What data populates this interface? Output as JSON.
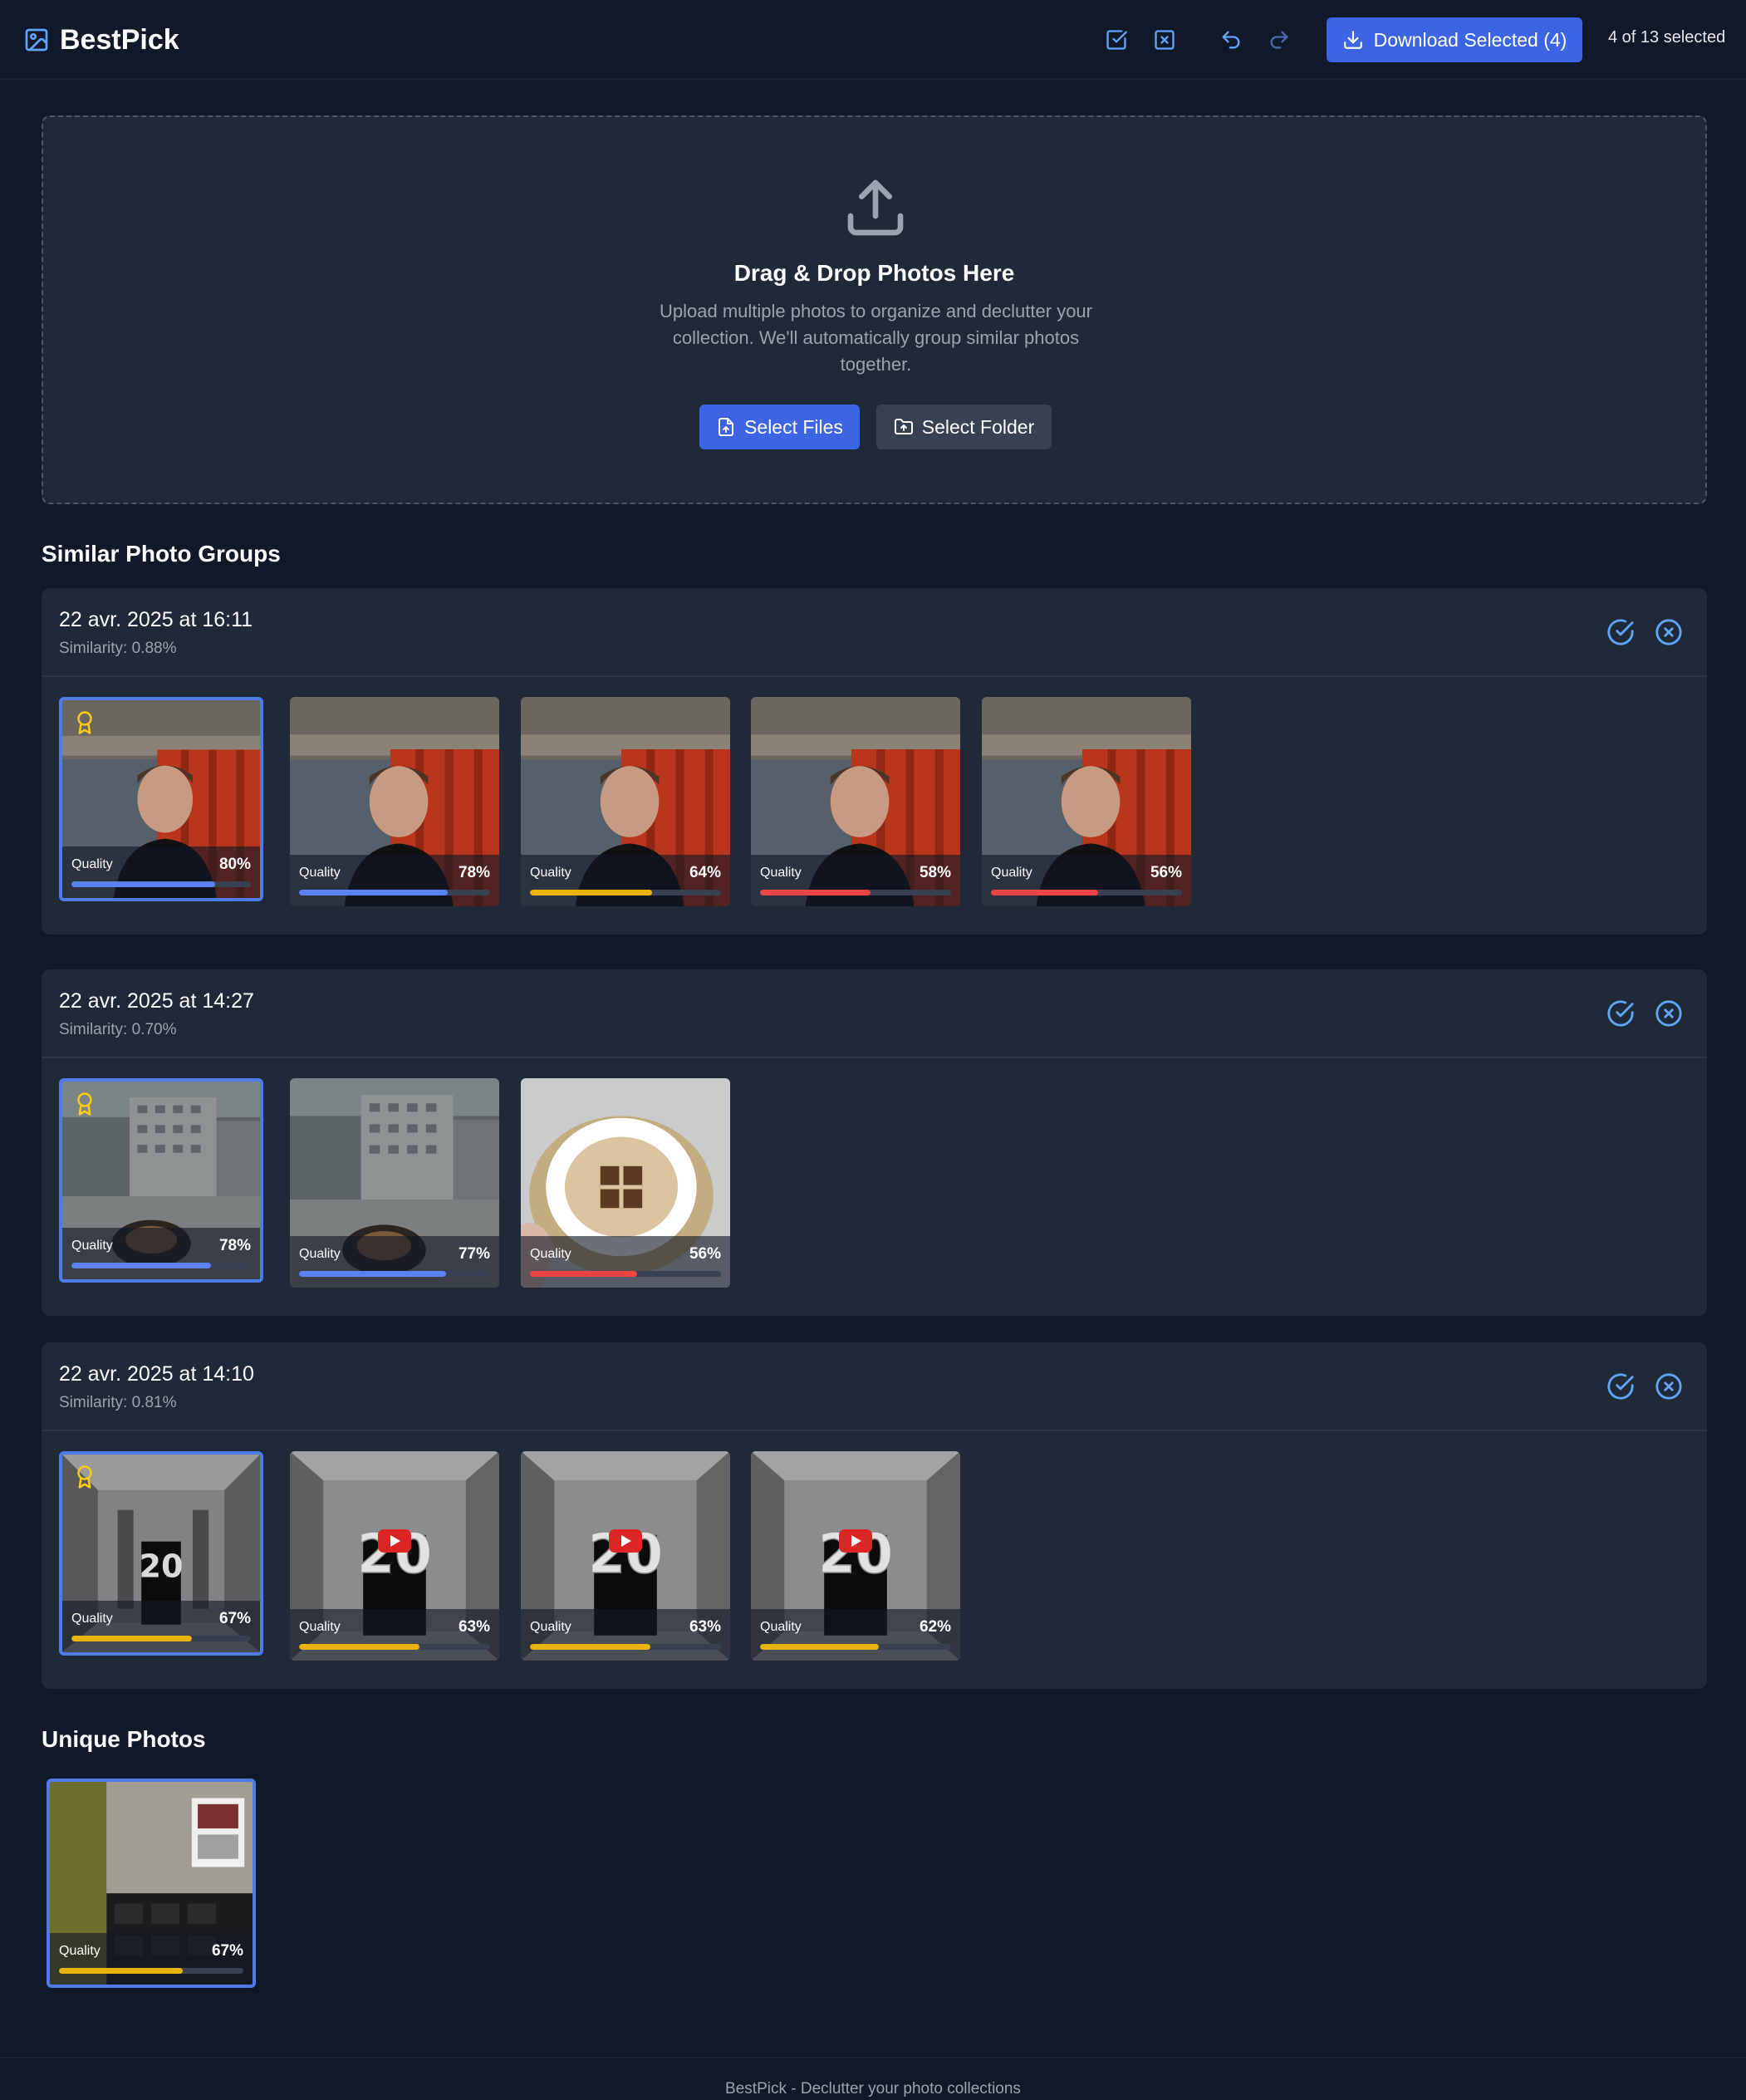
{
  "app": {
    "title": "BestPick"
  },
  "header": {
    "download_label": "Download Selected (4)",
    "selected_count": "4 of 13 selected"
  },
  "dropzone": {
    "title": "Drag & Drop Photos Here",
    "subtitle": "Upload multiple photos to organize and declutter your collection. We'll automatically group similar photos together.",
    "select_files": "Select Files",
    "select_folder": "Select Folder"
  },
  "similar": {
    "title": "Similar Photo Groups",
    "groups": [
      {
        "date": "22 avr. 2025 at 16:11",
        "similarity": "Similarity: 0.88%",
        "photos": [
          {
            "quality_label": "Quality",
            "quality": "80%",
            "value": 0.8,
            "best": true,
            "scene": "selfie",
            "color": "#5b82f0"
          },
          {
            "quality_label": "Quality",
            "quality": "78%",
            "value": 0.78,
            "scene": "selfie",
            "color": "#5b82f0"
          },
          {
            "quality_label": "Quality",
            "quality": "64%",
            "value": 0.64,
            "scene": "selfie",
            "color": "#eab308"
          },
          {
            "quality_label": "Quality",
            "quality": "58%",
            "value": 0.58,
            "scene": "selfie",
            "color": "#ef4444"
          },
          {
            "quality_label": "Quality",
            "quality": "56%",
            "value": 0.56,
            "scene": "selfie",
            "color": "#ef4444"
          }
        ]
      },
      {
        "date": "22 avr. 2025 at 14:27",
        "similarity": "Similarity: 0.70%",
        "photos": [
          {
            "quality_label": "Quality",
            "quality": "78%",
            "value": 0.78,
            "best": true,
            "scene": "building",
            "color": "#5b82f0"
          },
          {
            "quality_label": "Quality",
            "quality": "77%",
            "value": 0.77,
            "scene": "building",
            "color": "#5b82f0"
          },
          {
            "quality_label": "Quality",
            "quality": "56%",
            "value": 0.56,
            "scene": "coffee",
            "color": "#ef4444"
          }
        ]
      },
      {
        "date": "22 avr. 2025 at 14:10",
        "similarity": "Similarity: 0.81%",
        "photos": [
          {
            "quality_label": "Quality",
            "quality": "67%",
            "value": 0.67,
            "best": true,
            "scene": "hallway",
            "color": "#eab308"
          },
          {
            "quality_label": "Quality",
            "quality": "63%",
            "value": 0.63,
            "scene": "hallway-video",
            "color": "#eab308"
          },
          {
            "quality_label": "Quality",
            "quality": "63%",
            "value": 0.63,
            "scene": "hallway-video",
            "color": "#eab308"
          },
          {
            "quality_label": "Quality",
            "quality": "62%",
            "value": 0.62,
            "scene": "hallway-video",
            "color": "#eab308"
          }
        ]
      }
    ]
  },
  "unique": {
    "title": "Unique Photos",
    "photos": [
      {
        "quality_label": "Quality",
        "quality": "67%",
        "value": 0.67,
        "scene": "office",
        "color": "#eab308"
      }
    ]
  },
  "footer": {
    "text": "BestPick - Declutter your photo collections"
  },
  "icons": {
    "brand": "image-icon",
    "select_all": "check-square-icon",
    "deselect_all": "x-square-icon",
    "undo": "undo-icon",
    "redo": "redo-icon",
    "download": "download-icon",
    "upload": "upload-icon",
    "best": "award-icon",
    "group_select": "check-circle-icon",
    "group_deselect": "x-circle-icon"
  }
}
